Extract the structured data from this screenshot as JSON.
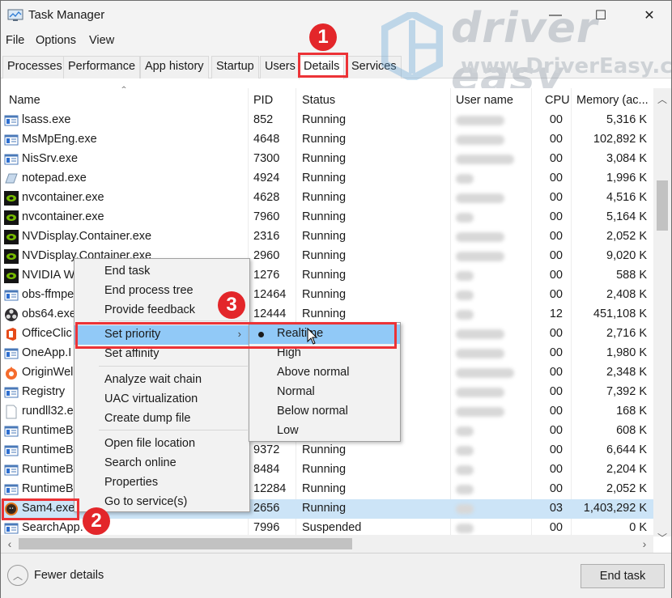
{
  "window": {
    "title": "Task Manager",
    "controls": {
      "minimize": "—",
      "maximize": "☐",
      "close": "✕"
    }
  },
  "menu": [
    "File",
    "Options",
    "View"
  ],
  "tabs": [
    {
      "label": "Processes",
      "active": false
    },
    {
      "label": "Performance",
      "active": false
    },
    {
      "label": "App history",
      "active": false
    },
    {
      "label": "Startup",
      "active": false
    },
    {
      "label": "Users",
      "active": false
    },
    {
      "label": "Details",
      "active": true
    },
    {
      "label": "Services",
      "active": false
    }
  ],
  "columns": {
    "name": "Name",
    "pid": "PID",
    "status": "Status",
    "user": "User name",
    "cpu": "CPU",
    "memory": "Memory (ac..."
  },
  "rows": [
    {
      "icon": "system-app-icon",
      "name": "lsass.exe",
      "pid": "852",
      "status": "Running",
      "cpu": "00",
      "memory": "5,316 K"
    },
    {
      "icon": "system-app-icon",
      "name": "MsMpEng.exe",
      "pid": "4648",
      "status": "Running",
      "cpu": "00",
      "memory": "102,892 K"
    },
    {
      "icon": "system-app-icon",
      "name": "NisSrv.exe",
      "pid": "7300",
      "status": "Running",
      "cpu": "00",
      "memory": "3,084 K"
    },
    {
      "icon": "notepad-icon",
      "name": "notepad.exe",
      "pid": "4924",
      "status": "Running",
      "cpu": "00",
      "memory": "1,996 K"
    },
    {
      "icon": "nvidia-icon",
      "name": "nvcontainer.exe",
      "pid": "4628",
      "status": "Running",
      "cpu": "00",
      "memory": "4,516 K"
    },
    {
      "icon": "nvidia-icon",
      "name": "nvcontainer.exe",
      "pid": "7960",
      "status": "Running",
      "cpu": "00",
      "memory": "5,164 K"
    },
    {
      "icon": "nvidia-icon",
      "name": "NVDisplay.Container.exe",
      "pid": "2316",
      "status": "Running",
      "cpu": "00",
      "memory": "2,052 K"
    },
    {
      "icon": "nvidia-icon",
      "name": "NVDisplay.Container.exe",
      "pid": "2960",
      "status": "Running",
      "cpu": "00",
      "memory": "9,020 K"
    },
    {
      "icon": "nvidia-icon",
      "name": "NVIDIA W",
      "pid": "1276",
      "status": "Running",
      "cpu": "00",
      "memory": "588 K"
    },
    {
      "icon": "system-app-icon",
      "name": "obs-ffmpe",
      "pid": "12464",
      "status": "Running",
      "cpu": "00",
      "memory": "2,408 K"
    },
    {
      "icon": "obs-icon",
      "name": "obs64.exe",
      "pid": "12444",
      "status": "Running",
      "cpu": "12",
      "memory": "451,108 K"
    },
    {
      "icon": "office-icon",
      "name": "OfficeClic",
      "pid": "",
      "status": "",
      "cpu": "00",
      "memory": "2,716 K"
    },
    {
      "icon": "system-app-icon",
      "name": "OneApp.I",
      "pid": "",
      "status": "",
      "cpu": "00",
      "memory": "1,980 K"
    },
    {
      "icon": "origin-icon",
      "name": "OriginWel",
      "pid": "",
      "status": "",
      "cpu": "00",
      "memory": "2,348 K"
    },
    {
      "icon": "system-app-icon",
      "name": "Registry",
      "pid": "",
      "status": "",
      "cpu": "00",
      "memory": "7,392 K"
    },
    {
      "icon": "file-icon",
      "name": "rundll32.e",
      "pid": "",
      "status": "",
      "cpu": "00",
      "memory": "168 K"
    },
    {
      "icon": "system-app-icon",
      "name": "RuntimeB",
      "pid": "",
      "status": "",
      "cpu": "00",
      "memory": "608 K"
    },
    {
      "icon": "system-app-icon",
      "name": "RuntimeB",
      "pid": "9372",
      "status": "Running",
      "cpu": "00",
      "memory": "6,644 K"
    },
    {
      "icon": "system-app-icon",
      "name": "RuntimeB",
      "pid": "8484",
      "status": "Running",
      "cpu": "00",
      "memory": "2,204 K"
    },
    {
      "icon": "system-app-icon",
      "name": "RuntimeB",
      "pid": "12284",
      "status": "Running",
      "cpu": "00",
      "memory": "2,052 K"
    },
    {
      "icon": "sam-icon",
      "name": "Sam4.exe",
      "pid": "2656",
      "status": "Running",
      "cpu": "03",
      "memory": "1,403,292 K",
      "selected": true
    },
    {
      "icon": "system-app-icon",
      "name": "SearchApp.",
      "pid": "7996",
      "status": "Suspended",
      "cpu": "00",
      "memory": "0 K"
    }
  ],
  "context_menu": {
    "items": [
      {
        "label": "End task"
      },
      {
        "label": "End process tree"
      },
      {
        "label": "Provide feedback"
      },
      {
        "label": "Set priority",
        "submenu": true,
        "hover": true
      },
      {
        "label": "Set affinity"
      },
      {
        "label": "Analyze wait chain"
      },
      {
        "label": "UAC virtualization"
      },
      {
        "label": "Create dump file"
      },
      {
        "label": "Open file location"
      },
      {
        "label": "Search online"
      },
      {
        "label": "Properties"
      },
      {
        "label": "Go to service(s)"
      }
    ],
    "submenu_arrow": "›"
  },
  "priority_submenu": {
    "items": [
      {
        "label": "Realtime",
        "checked": true,
        "hover": true
      },
      {
        "label": "High"
      },
      {
        "label": "Above normal"
      },
      {
        "label": "Normal"
      },
      {
        "label": "Below normal"
      },
      {
        "label": "Low"
      }
    ]
  },
  "footer": {
    "fewer_details": "Fewer details",
    "end_task": "End task"
  },
  "annotations": {
    "step1": "1",
    "step2": "2",
    "step3": "3",
    "color": "#e3262a"
  },
  "watermark": {
    "brand": "driver easy",
    "url": "www.DriverEasy.com"
  },
  "colors": {
    "selection": "#cce4f7",
    "menu_hover": "#91c9f7",
    "highlight_border": "#ec3337"
  }
}
